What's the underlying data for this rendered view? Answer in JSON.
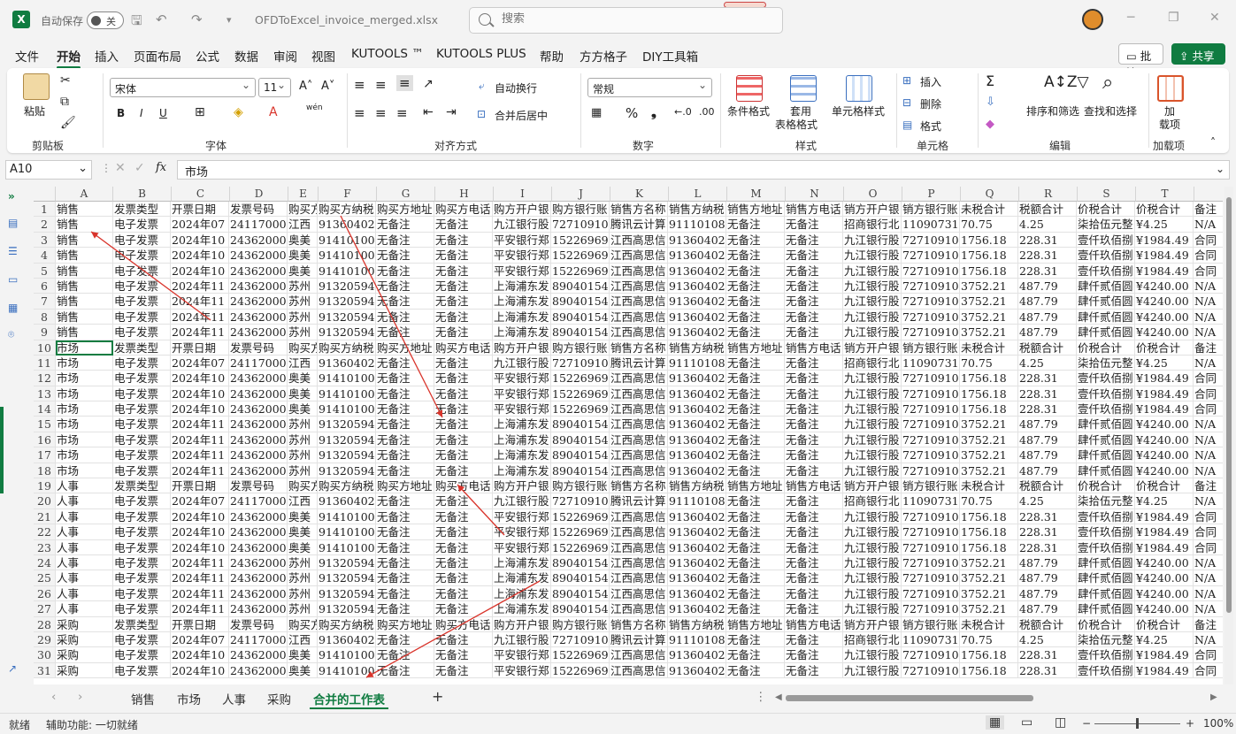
{
  "title": {
    "autosave_label": "自动保存",
    "toggle_state": "关",
    "filename": "OFDToExcel_invoice_merged.xlsx",
    "search_placeholder": "搜索"
  },
  "menu": [
    "文件",
    "开始",
    "插入",
    "页面布局",
    "公式",
    "数据",
    "审阅",
    "视图",
    "KUTOOLS ™",
    "KUTOOLS PLUS",
    "帮助",
    "方方格子",
    "DIY工具箱"
  ],
  "menu_active": "开始",
  "comment_btn": "批注",
  "share_btn": "共享",
  "ribbon": {
    "paste": "粘贴",
    "clipboard": "剪贴板",
    "font_name": "宋体",
    "font_size": "11",
    "font_group": "字体",
    "wrap": "自动换行",
    "merge": "合并后居中",
    "align_group": "对齐方式",
    "number_format": "常规",
    "number_group": "数字",
    "cond_format": "条件格式",
    "table_format_1": "套用",
    "table_format_2": "表格格式",
    "cell_style": "单元格样式",
    "style_group": "样式",
    "insert": "插入",
    "delete": "删除",
    "format": "格式",
    "cells_group": "单元格",
    "sort_filter": "排序和筛选",
    "find_select": "查找和选择",
    "edit_group": "编辑",
    "addins_1": "加",
    "addins_2": "载项",
    "addins_group": "加载项",
    "wen": "wén"
  },
  "formula": {
    "namebox": "A10",
    "fx": "fx",
    "content": "市场"
  },
  "columns": [
    "A",
    "B",
    "C",
    "D",
    "E",
    "F",
    "G",
    "H",
    "I",
    "J",
    "K",
    "L",
    "M",
    "N",
    "O",
    "P",
    "Q",
    "R",
    "S",
    "T",
    ""
  ],
  "row_numbers": [
    "1",
    "2",
    "3",
    "4",
    "5",
    "6",
    "7",
    "8",
    "9",
    "10",
    "11",
    "12",
    "13",
    "14",
    "15",
    "16",
    "17",
    "18",
    "19",
    "20",
    "21",
    "22",
    "23",
    "24",
    "25",
    "26",
    "27",
    "28",
    "29",
    "30",
    "31"
  ],
  "row_labels": [
    "销售",
    "销售",
    "销售",
    "销售",
    "销售",
    "销售",
    "销售",
    "销售",
    "销售",
    "市场",
    "市场",
    "市场",
    "市场",
    "市场",
    "市场",
    "市场",
    "市场",
    "市场",
    "人事",
    "人事",
    "人事",
    "人事",
    "人事",
    "人事",
    "人事",
    "人事",
    "人事",
    "采购",
    "采购",
    "采购",
    "采购"
  ],
  "header_row": [
    "发票类型",
    "开票日期",
    "发票号码",
    "购买方",
    "购买方纳税",
    "购买方地址",
    "购买方电话",
    "购方开户银",
    "购方银行账",
    "销售方名称",
    "销售方纳税",
    "销售方地址",
    "销售方电话",
    "销方开户银",
    "销方银行账",
    "未税合计",
    "税额合计",
    "价税合计",
    "价税合计",
    "备注"
  ],
  "data_rows": [
    [
      "电子发票",
      "2024年07",
      "24117000C",
      "江西",
      "91360402M",
      "无备注",
      "无备注",
      "九江银行股",
      "72710910C",
      "腾讯云计算",
      "911101085",
      "无备注",
      "无备注",
      "招商银行北",
      "110907316",
      "70.75",
      "4.25",
      "柒拾伍元整",
      "¥4.25",
      "N/A"
    ],
    [
      "电子发票",
      "2024年10",
      "24362000C",
      "奥美",
      "91410100M",
      "无备注",
      "无备注",
      "平安银行郑",
      "152269692",
      "江西高思信",
      "91360402M",
      "无备注",
      "无备注",
      "九江银行股",
      "72710910C",
      "1756.18",
      "228.31",
      "壹仟玖佰捌",
      "¥1984.49",
      "合同"
    ],
    [
      "电子发票",
      "2024年10",
      "24362000C",
      "奥美",
      "91410100M",
      "无备注",
      "无备注",
      "平安银行郑",
      "152269692",
      "江西高思信",
      "91360402M",
      "无备注",
      "无备注",
      "九江银行股",
      "72710910C",
      "1756.18",
      "228.31",
      "壹仟玖佰捌",
      "¥1984.49",
      "合同"
    ],
    [
      "电子发票",
      "2024年10",
      "24362000C",
      "奥美",
      "91410100M",
      "无备注",
      "无备注",
      "平安银行郑",
      "152269692",
      "江西高思信",
      "91360402M",
      "无备注",
      "无备注",
      "九江银行股",
      "72710910C",
      "1756.18",
      "228.31",
      "壹仟玖佰捌",
      "¥1984.49",
      "合同"
    ],
    [
      "电子发票",
      "2024年11",
      "24362000C",
      "苏州",
      "913205943",
      "无备注",
      "无备注",
      "上海浦东发",
      "890401547",
      "江西高思信",
      "91360402M",
      "无备注",
      "无备注",
      "九江银行股",
      "72710910C",
      "3752.21",
      "487.79",
      "肆仟贰佰圆",
      "¥4240.00",
      "N/A"
    ],
    [
      "电子发票",
      "2024年11",
      "24362000C",
      "苏州",
      "913205943",
      "无备注",
      "无备注",
      "上海浦东发",
      "890401547",
      "江西高思信",
      "91360402M",
      "无备注",
      "无备注",
      "九江银行股",
      "72710910C",
      "3752.21",
      "487.79",
      "肆仟贰佰圆",
      "¥4240.00",
      "N/A"
    ],
    [
      "电子发票",
      "2024年11",
      "24362000C",
      "苏州",
      "913205943",
      "无备注",
      "无备注",
      "上海浦东发",
      "890401547",
      "江西高思信",
      "91360402M",
      "无备注",
      "无备注",
      "九江银行股",
      "72710910C",
      "3752.21",
      "487.79",
      "肆仟贰佰圆",
      "¥4240.00",
      "N/A"
    ],
    [
      "电子发票",
      "2024年11",
      "24362000C",
      "苏州",
      "913205943",
      "无备注",
      "无备注",
      "上海浦东发",
      "890401547",
      "江西高思信",
      "91360402M",
      "无备注",
      "无备注",
      "九江银行股",
      "72710910C",
      "3752.21",
      "487.79",
      "肆仟贰佰圆",
      "¥4240.00",
      "N/A"
    ]
  ],
  "sheet_tabs": [
    "销售",
    "市场",
    "人事",
    "采购",
    "合并的工作表"
  ],
  "active_sheet": "合并的工作表",
  "status": {
    "ready": "就绪",
    "accessibility": "辅助功能: 一切就绪",
    "zoom": "100%"
  },
  "colors": {
    "accent": "#107c41",
    "arrow": "#d9342b"
  }
}
